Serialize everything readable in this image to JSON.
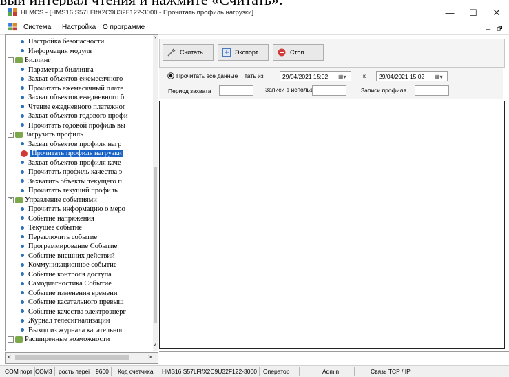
{
  "caption": "вый интервал чтения и нажмите «Считать».",
  "window": {
    "title": "HLMCS - [HMS16 S57LFlfX2C9U32F122-3000 - Прочитать профиль нагрузки]",
    "minimize": "—",
    "maximize": "☐",
    "close": "✕",
    "mdi_minimize": "_",
    "mdi_restore": "🗗"
  },
  "menu": [
    "Система",
    "Настройка",
    "О программе"
  ],
  "tree": [
    {
      "label": "Настройка безопасности",
      "level": 1
    },
    {
      "label": "Информация модуля",
      "level": 1
    },
    {
      "label": "Биллинг",
      "level": 0
    },
    {
      "label": "Параметры биллинга",
      "level": 1
    },
    {
      "label": "Захват объектов ежемесячного",
      "level": 1
    },
    {
      "label": "Прочитать ежемесячный плате",
      "level": 1
    },
    {
      "label": "Захват объектов ежедневного б",
      "level": 1
    },
    {
      "label": "Чтение ежедневного платежног",
      "level": 1
    },
    {
      "label": "Захват объектов годового профи",
      "level": 1
    },
    {
      "label": "Прочитать годовой профиль вы",
      "level": 1
    },
    {
      "label": "Загрузить профиль",
      "level": 0
    },
    {
      "label": "Захват объектов профиля нагр",
      "level": 1
    },
    {
      "label": "Прочитать профиль нагрузки",
      "level": 1,
      "selected": true
    },
    {
      "label": "Захват объектов профиля каче",
      "level": 1
    },
    {
      "label": "Прочитать профиль качества э",
      "level": 1
    },
    {
      "label": "Захватить объекты текущего п",
      "level": 1
    },
    {
      "label": "Прочитать текущий профиль",
      "level": 1
    },
    {
      "label": "Управление событиями",
      "level": 0
    },
    {
      "label": "Прочитать информацию о меро",
      "level": 1
    },
    {
      "label": "Событие напряжения",
      "level": 1
    },
    {
      "label": "Текущее событие",
      "level": 1
    },
    {
      "label": "Переключить событие",
      "level": 1
    },
    {
      "label": "Программирование Событие",
      "level": 1
    },
    {
      "label": "Событие внешних действий",
      "level": 1
    },
    {
      "label": "Коммуникационное событие",
      "level": 1
    },
    {
      "label": "Событие контроля доступа",
      "level": 1
    },
    {
      "label": "Самодиагностика Событие",
      "level": 1
    },
    {
      "label": "Событие изменения времени",
      "level": 1
    },
    {
      "label": "Событие касательного превыш",
      "level": 1
    },
    {
      "label": "Событие качества электроэнерг",
      "level": 1
    },
    {
      "label": "Журнал телесигнализации",
      "level": 1
    },
    {
      "label": "Выход из журнала касательног",
      "level": 1
    },
    {
      "label": "Расширенные возможности",
      "level": 0
    }
  ],
  "toolbar": {
    "read_label": "Считать",
    "export_label": "Экспорт",
    "stop_label": "Стоп"
  },
  "options": {
    "read_all_label": "Прочитать все данные",
    "read_from_label": "тать из",
    "from_date": "29/04/2021 15:02",
    "to_label": "к",
    "to_date": "29/04/2021 15:02",
    "capture_period_label": "Период захвата",
    "records_in_use_label": "Записи в использс",
    "profile_records_label": "Записи профиля"
  },
  "status": [
    "COM порт",
    "COM3",
    "рость переі",
    "9600",
    "Код счетчика",
    "HMS16 S57LFlfX2C9U32F122-3000",
    "Оператор",
    "Admin",
    "Связь TCP / IP"
  ],
  "colors": {
    "selection": "#1a64c8",
    "bullet": "#2a6fb8",
    "folder": "#7aa84a",
    "stop_icon": "#d23a3a"
  }
}
